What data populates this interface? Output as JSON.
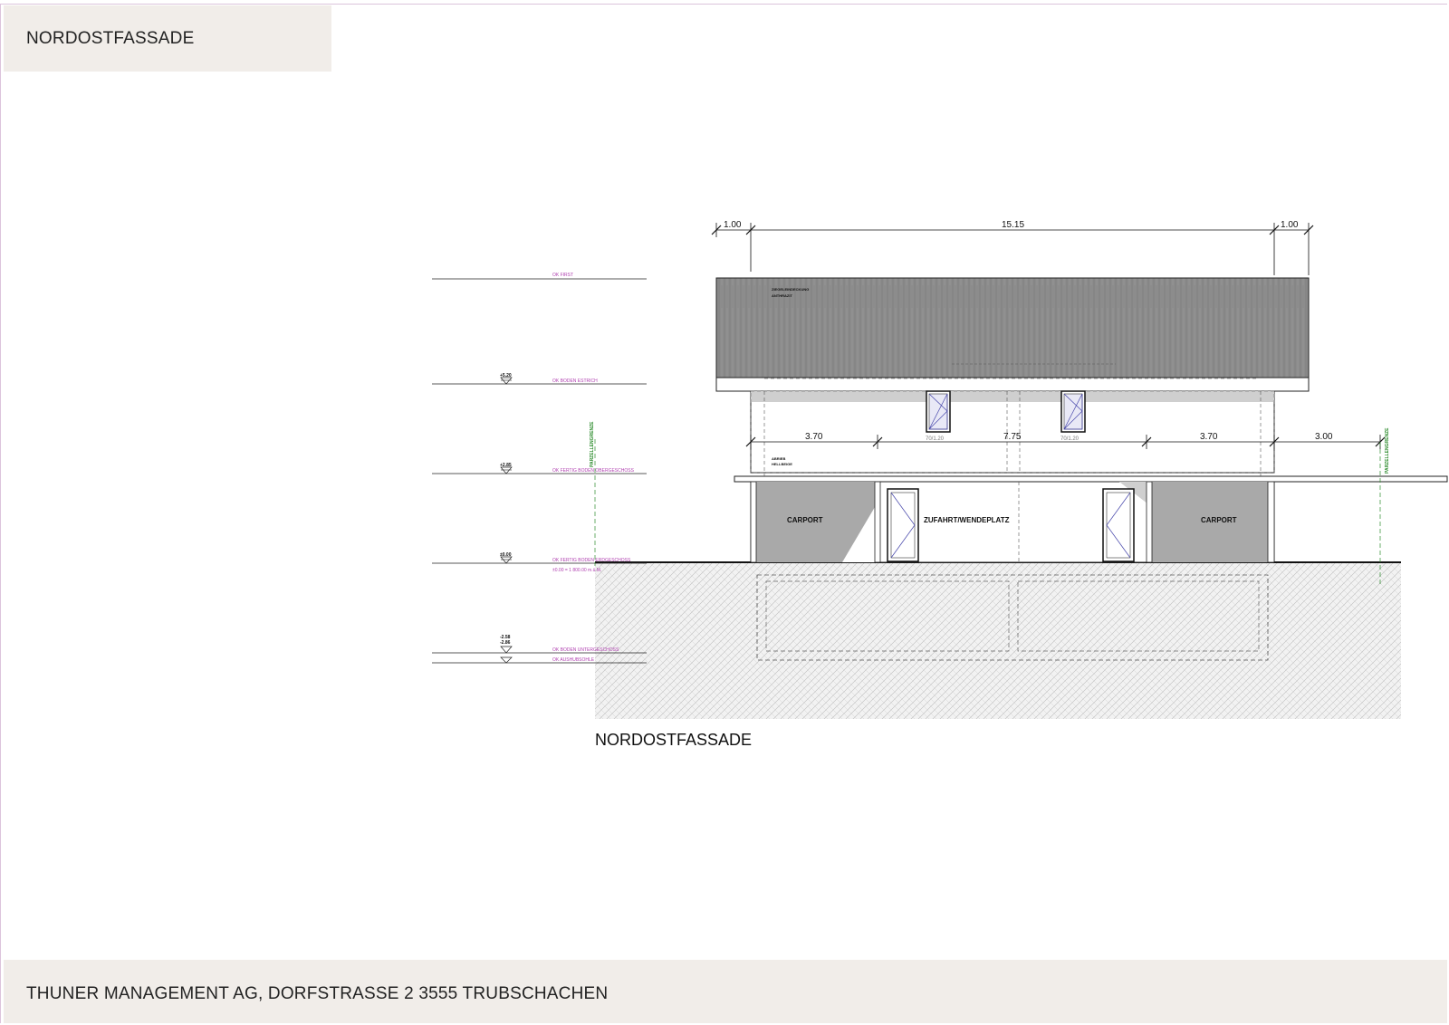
{
  "page": {
    "title": "NORDOSTFASSADE",
    "footer": "THUNER MANAGEMENT AG, DORFSTRASSE 2 3555 TRUBSCHACHEN"
  },
  "drawing": {
    "caption": "NORDOSTFASSADE",
    "top_dimensions": [
      "1.00",
      "15.15",
      "1.00"
    ],
    "mid_dimensions": [
      "3.70",
      "7.75",
      "3.70",
      "3.00"
    ],
    "levels": [
      {
        "label": "OK FIRST",
        "value": ""
      },
      {
        "label": "OK BODEN ESTRICH",
        "value": "+5.20"
      },
      {
        "label": "OK FERTIG BODEN OBERGESCHOSS",
        "value": "+2.85"
      },
      {
        "label": "OK FERTIG BODEN ERDGESCHOSS",
        "value": "±0.00",
        "note": "±0.00 = 1 800.00 m.ü.M."
      },
      {
        "label": "OK BODEN UNTERGESCHOSS",
        "value": "-2.58"
      },
      {
        "label": "OK AUSHUBSOHLE",
        "value": "-2.86"
      }
    ],
    "labels": {
      "carport_left": "CARPORT",
      "carport_right": "CARPORT",
      "driveway": "ZUFAHRT/WENDEPLATZ",
      "roof_note_1": "ZIEGELEINDECKUNG",
      "roof_note_2": "ANTHRAZIT",
      "wall_note_1": "ABRIEB",
      "wall_note_2": "HELLBEIGE",
      "window_1": "70/1.20",
      "window_2": "70/1.20",
      "boundary_left": "PARZELLENGRENZE",
      "boundary_right": "PARZELLENGRENZE"
    }
  }
}
